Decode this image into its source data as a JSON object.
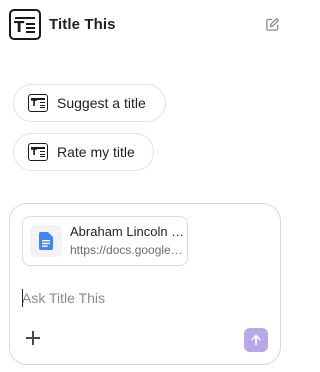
{
  "header": {
    "title": "Title This",
    "app_icon": "title-this-logo-icon",
    "new_chat_icon": "edit-square-icon"
  },
  "suggestions": [
    {
      "label": "Suggest a title",
      "icon": "title-this-logo-icon"
    },
    {
      "label": "Rate my title",
      "icon": "title-this-logo-icon"
    }
  ],
  "composer": {
    "attachment": {
      "title": "Abraham Lincoln Biography",
      "url": "https://docs.google.com/document",
      "icon": "google-docs-icon"
    },
    "input_value": "",
    "placeholder": "Ask Title This",
    "add_icon": "plus-icon",
    "send_icon": "arrow-up-icon"
  },
  "colors": {
    "send_button": "#b9a8e8",
    "docs_blue": "#4285f4"
  }
}
